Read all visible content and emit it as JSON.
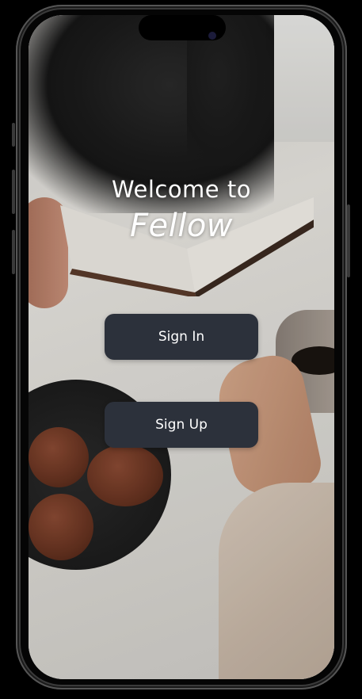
{
  "welcome": {
    "line1": "Welcome to",
    "line2": "Fellow"
  },
  "buttons": {
    "sign_in": "Sign In",
    "sign_up": "Sign Up"
  },
  "colors": {
    "button_bg": "#2c313b",
    "button_text": "#ffffff",
    "title_text": "#ffffff"
  }
}
